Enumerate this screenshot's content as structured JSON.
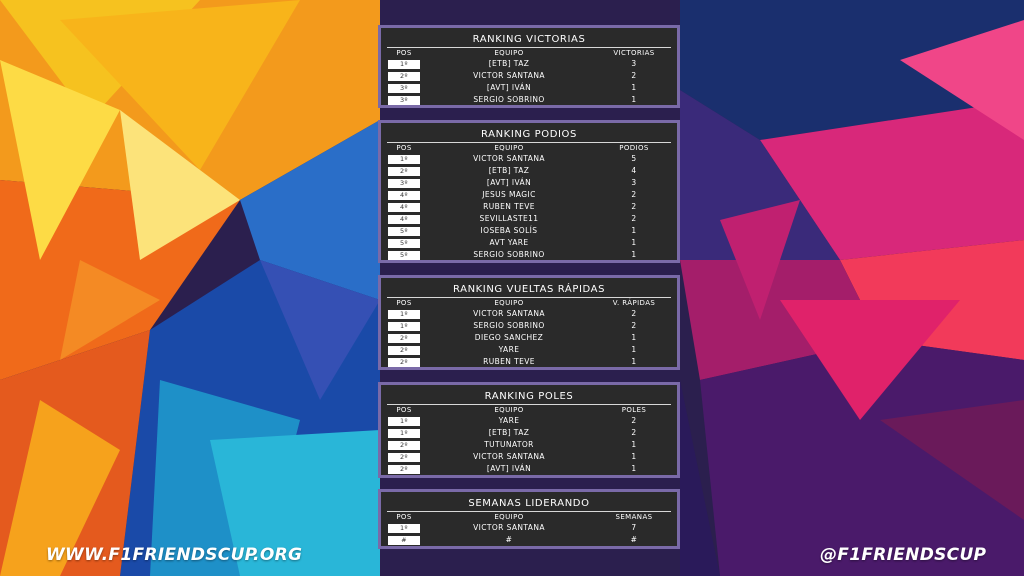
{
  "panels": [
    {
      "title": "RANKING VICTORIAS",
      "headers": [
        "POS",
        "EQUIPO",
        "VICTORIAS"
      ],
      "rows": [
        {
          "pos": "1º",
          "team": "[ETB] TAZ",
          "value": "3"
        },
        {
          "pos": "2º",
          "team": "VICTOR SANTANA",
          "value": "2"
        },
        {
          "pos": "3º",
          "team": "[AVT] IVÁN",
          "value": "1"
        },
        {
          "pos": "3º",
          "team": "SERGIO SOBRINO",
          "value": "1"
        }
      ]
    },
    {
      "title": "RANKING PODIOS",
      "headers": [
        "POS",
        "EQUIPO",
        "PODIOS"
      ],
      "rows": [
        {
          "pos": "1º",
          "team": "VICTOR SANTANA",
          "value": "5"
        },
        {
          "pos": "2º",
          "team": "[ETB] TAZ",
          "value": "4"
        },
        {
          "pos": "3º",
          "team": "[AVT] IVÁN",
          "value": "3"
        },
        {
          "pos": "4º",
          "team": "JESUS MAGIC",
          "value": "2"
        },
        {
          "pos": "4º",
          "team": "RUBEN TEVE",
          "value": "2"
        },
        {
          "pos": "4º",
          "team": "SEVILLASTE11",
          "value": "2"
        },
        {
          "pos": "5º",
          "team": "IOSEBA SOLÍS",
          "value": "1"
        },
        {
          "pos": "5º",
          "team": "AVT YARE",
          "value": "1"
        },
        {
          "pos": "5º",
          "team": "SERGIO SOBRINO",
          "value": "1"
        }
      ]
    },
    {
      "title": "RANKING VUELTAS RÁPIDAS",
      "headers": [
        "POS",
        "EQUIPO",
        "V. RÁPIDAS"
      ],
      "rows": [
        {
          "pos": "1º",
          "team": "VICTOR SANTANA",
          "value": "2"
        },
        {
          "pos": "1º",
          "team": "SERGIO SOBRINO",
          "value": "2"
        },
        {
          "pos": "2º",
          "team": "DIEGO SANCHEZ",
          "value": "1"
        },
        {
          "pos": "2º",
          "team": "YARE",
          "value": "1"
        },
        {
          "pos": "2º",
          "team": "RUBEN TEVE",
          "value": "1"
        }
      ]
    },
    {
      "title": "RANKING POLES",
      "headers": [
        "POS",
        "EQUIPO",
        "POLES"
      ],
      "rows": [
        {
          "pos": "1º",
          "team": "YARE",
          "value": "2"
        },
        {
          "pos": "1º",
          "team": "[ETB] TAZ",
          "value": "2"
        },
        {
          "pos": "2º",
          "team": "TUTUNATOR",
          "value": "1"
        },
        {
          "pos": "2º",
          "team": "VICTOR SANTANA",
          "value": "1"
        },
        {
          "pos": "2º",
          "team": "[AVT] IVÁN",
          "value": "1"
        }
      ]
    },
    {
      "title": "SEMANAS LIDERANDO",
      "headers": [
        "POS",
        "EQUIPO",
        "SEMANAS"
      ],
      "rows": [
        {
          "pos": "1º",
          "team": "VICTOR SANTANA",
          "value": "7"
        },
        {
          "pos": "#",
          "team": "#",
          "value": "#"
        }
      ]
    }
  ],
  "footer": {
    "website": "WWW.F1FRIENDSCUP.ORG",
    "handle": "@F1FRIENDSCUP"
  },
  "colors": {
    "panel_bg": "#2a2a2a",
    "panel_border": "#7a6aa8"
  }
}
